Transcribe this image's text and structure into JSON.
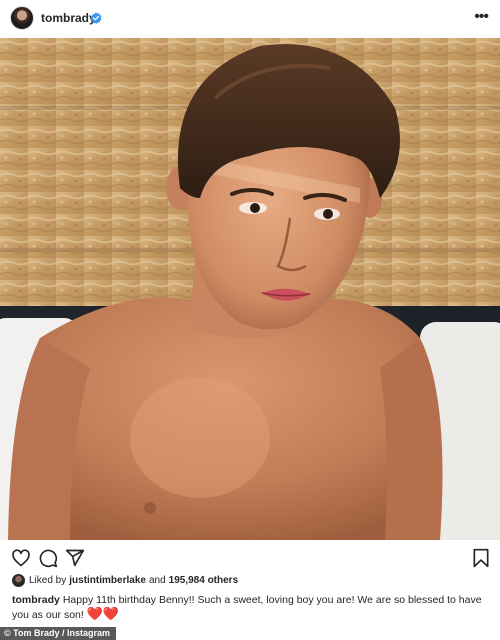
{
  "header": {
    "username": "tombrady",
    "verified": true,
    "more_icon": "more-horizontal-icon",
    "more_label": "•••"
  },
  "photo": {
    "subject": "boy portrait"
  },
  "actions": {
    "icons": [
      "heart-icon",
      "comment-icon",
      "share-icon",
      "bookmark-icon"
    ]
  },
  "likes": {
    "prefix": "Liked by",
    "user": "justintimberlake",
    "middle": "and",
    "count": "195,984 others"
  },
  "caption": {
    "username": "tombrady",
    "text": "Happy 11th birthday Benny!! Such a sweet, loving boy you are! We are so blessed to have you as our son!",
    "emoji": "❤️❤️"
  },
  "credit": {
    "text": "© Tom Brady / Instagram"
  },
  "colors": {
    "text": "#262626",
    "verified": "#3897f0",
    "heart_emoji": "#e0245e",
    "wall": "#c9a373"
  }
}
